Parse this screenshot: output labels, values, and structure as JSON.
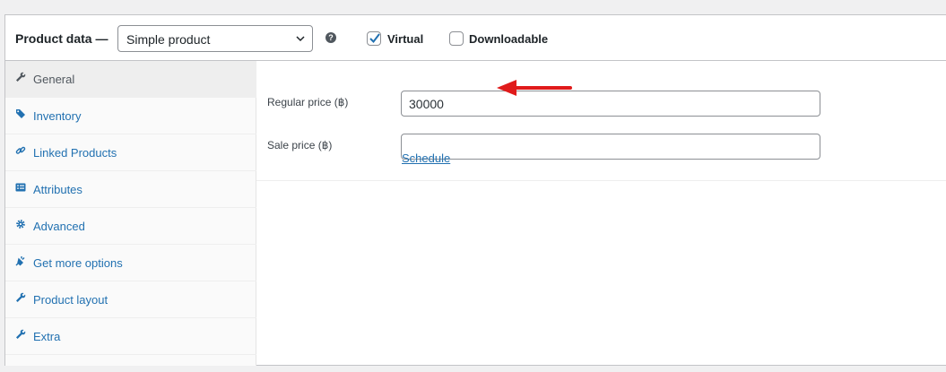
{
  "header": {
    "title": "Product data —",
    "product_type": "Simple product",
    "help_glyph": "?",
    "virtual_label": "Virtual",
    "virtual_checked": true,
    "downloadable_label": "Downloadable",
    "downloadable_checked": false
  },
  "tabs": [
    {
      "label": "General",
      "icon": "wrench-icon",
      "active": true
    },
    {
      "label": "Inventory",
      "icon": "tag-icon",
      "active": false
    },
    {
      "label": "Linked Products",
      "icon": "link-icon",
      "active": false
    },
    {
      "label": "Attributes",
      "icon": "list-card-icon",
      "active": false
    },
    {
      "label": "Advanced",
      "icon": "gear-icon",
      "active": false
    },
    {
      "label": "Get more options",
      "icon": "plugin-icon",
      "active": false
    },
    {
      "label": "Product layout",
      "icon": "wrench-icon",
      "active": false
    },
    {
      "label": "Extra",
      "icon": "wrench-icon",
      "active": false
    }
  ],
  "general": {
    "regular_price_label": "Regular price (฿)",
    "regular_price_value": "30000",
    "sale_price_label": "Sale price (฿)",
    "sale_price_value": "",
    "schedule_link": "Schedule"
  },
  "colors": {
    "link": "#2271b1",
    "annotation_arrow": "#e01b1b"
  }
}
